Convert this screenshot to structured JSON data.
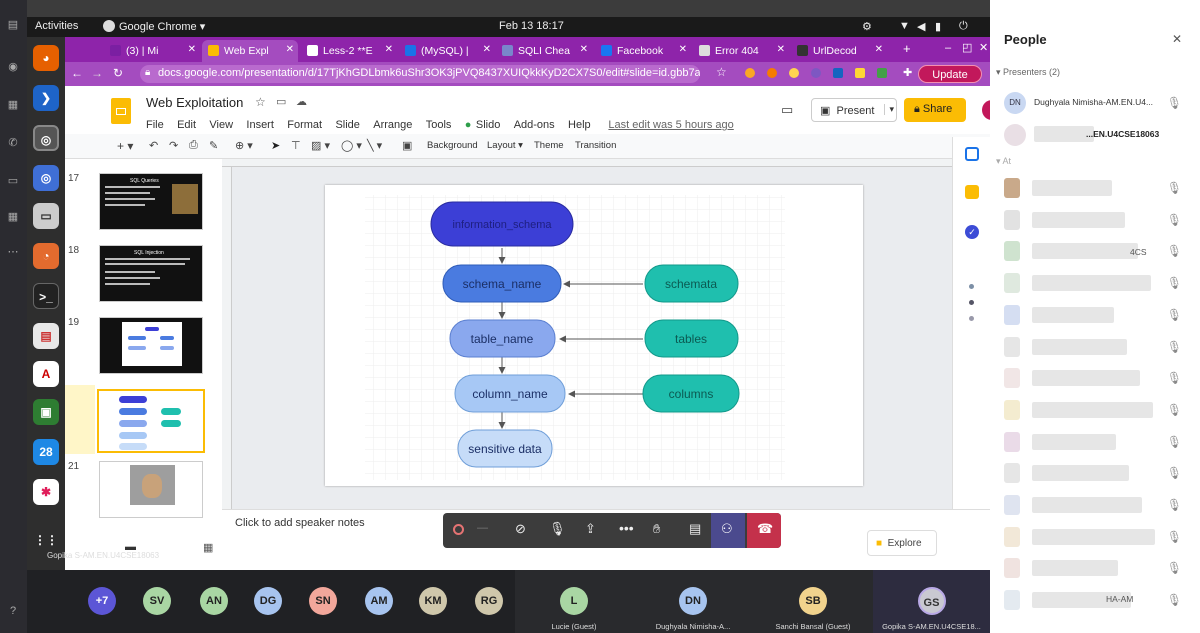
{
  "gnome": {
    "activities": "Activities",
    "app": "Google Chrome ▾",
    "datetime": "Feb 13  18:17"
  },
  "tabs": [
    {
      "label": "(3) | Mi",
      "color": "#7b1fa2"
    },
    {
      "label": "Web Expl",
      "color": "#fbbc04"
    },
    {
      "label": "Less-2 **E",
      "color": "#ffffff"
    },
    {
      "label": "(MySQL) |",
      "color": "#1a73e8"
    },
    {
      "label": "SQLI Chea",
      "color": "#7986cb"
    },
    {
      "label": "Facebook",
      "color": "#1877f2"
    },
    {
      "label": "Error 404",
      "color": "#dddddd"
    },
    {
      "label": "UrlDecod",
      "color": "#333333"
    }
  ],
  "omnibar": {
    "url": "docs.google.com/presentation/d/17TjKhGDLbmk6uShr3OK3jPVQ8437XUIQkkKyD2CX7S0/edit#slide=id.gbb7ae…",
    "update": "Update"
  },
  "doc": {
    "title": "Web Exploitation",
    "menus": [
      "File",
      "Edit",
      "View",
      "Insert",
      "Format",
      "Slide",
      "Arrange",
      "Tools",
      "Slido",
      "Add-ons",
      "Help"
    ],
    "last_edit": "Last edit was 5 hours ago",
    "present": "Present",
    "share": "Share"
  },
  "toolbar": {
    "background": "Background",
    "layout": "Layout ▾",
    "theme": "Theme",
    "transition": "Transition"
  },
  "slides": [
    {
      "num": "17",
      "title": "SQL Queries"
    },
    {
      "num": "18",
      "title": "SQL Injection"
    },
    {
      "num": "19",
      "title": ""
    },
    {
      "num": "20",
      "title": ""
    },
    {
      "num": "21",
      "title": ""
    }
  ],
  "diagram": {
    "top": "information_schema",
    "left": [
      "schema_name",
      "table_name",
      "column_name",
      "sensitive data"
    ],
    "right": [
      "schemata",
      "tables",
      "columns"
    ],
    "colors": {
      "top": "#3c3fd6",
      "schema": "#4a7be0",
      "table": "#8aa8ee",
      "column": "#a7c8f5",
      "sensitive": "#c6dcf8",
      "teal": "#1fbfae"
    }
  },
  "notes": {
    "placeholder": "Click to add speaker notes",
    "explore": "Explore"
  },
  "participants": {
    "avatars": [
      {
        "initials": "+7",
        "color": "#5c56d6"
      },
      {
        "initials": "SV",
        "color": "#a9d6a3"
      },
      {
        "initials": "AN",
        "color": "#a9d6a3"
      },
      {
        "initials": "DG",
        "color": "#a7c4ef"
      },
      {
        "initials": "SN",
        "color": "#f2a79b"
      },
      {
        "initials": "AM",
        "color": "#a7c4ef"
      },
      {
        "initials": "KM",
        "color": "#cfc7ab"
      },
      {
        "initials": "RG",
        "color": "#cfc7ab"
      }
    ],
    "named": [
      {
        "initials": "L",
        "name": "Lucie (Guest)",
        "color": "#a9d6a3"
      },
      {
        "initials": "DN",
        "name": "Dughyala Nimisha-A...",
        "color": "#a7c4ef"
      },
      {
        "initials": "SB",
        "name": "Sanchi Bansal (Guest)",
        "color": "#f1d38d"
      },
      {
        "initials": "GS",
        "name": "Gopika S-AM.EN.U4CSE18...",
        "color": "#c9c9d1"
      }
    ],
    "self_label": "Gopika S-AM.EN.U4CSE18063"
  },
  "people": {
    "title": "People",
    "presenters": "Presenters (2)",
    "p1_initials": "DN",
    "p1_name": "Dughyala Nimisha-AM.EN.U4...",
    "p2_name": "...EN.U4CSE18063",
    "attendees_head": "At",
    "partial_1": "4CS",
    "partial_2": "HA-AM"
  }
}
